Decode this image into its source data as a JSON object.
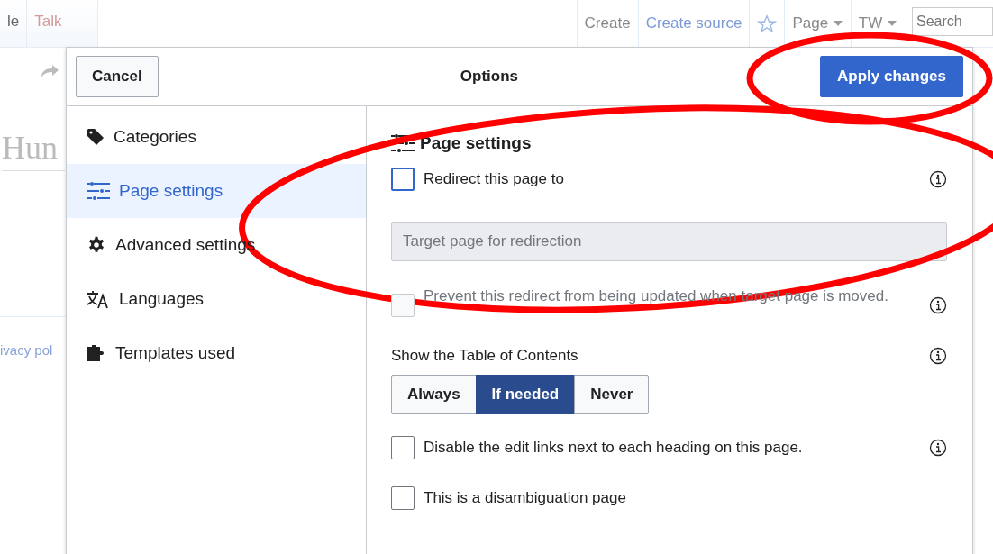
{
  "page": {
    "tabs": [
      {
        "label": "le"
      },
      {
        "label": "Talk"
      }
    ],
    "actions": [
      {
        "kind": "link",
        "label": "Create"
      },
      {
        "kind": "link",
        "label": "Create source"
      },
      {
        "kind": "star"
      },
      {
        "kind": "menu",
        "label": "Page"
      },
      {
        "kind": "menu",
        "label": "TW"
      }
    ],
    "search": {
      "placeholder": "Search"
    },
    "title": "Hun",
    "footer_link": "ivacy pol"
  },
  "dialog": {
    "title": "Options",
    "cancel": "Cancel",
    "apply": "Apply changes",
    "sidebar": [
      {
        "kind": "tag",
        "label": "Categories",
        "selected": false
      },
      {
        "kind": "sliders",
        "label": "Page settings",
        "selected": true
      },
      {
        "kind": "gear",
        "label": "Advanced settings",
        "selected": false
      },
      {
        "kind": "language",
        "label": "Languages",
        "selected": false
      },
      {
        "kind": "puzzle",
        "label": "Templates used",
        "selected": false
      }
    ],
    "heading": "Page settings",
    "rows": [
      {
        "kind": "checkbox",
        "label": "Redirect this page to",
        "checked": false,
        "disabled": false,
        "help": true
      },
      {
        "kind": "field",
        "placeholder": "Target page for redirection",
        "disabled": true
      },
      {
        "kind": "checkbox",
        "label": "Prevent this redirect from being updated when target page is moved.",
        "checked": false,
        "disabled": true,
        "help": true
      },
      {
        "kind": "choice",
        "label": "Show the Table of Contents",
        "help": true,
        "options": [
          {
            "label": "Always",
            "selected": false
          },
          {
            "label": "If needed",
            "selected": true
          },
          {
            "label": "Never",
            "selected": false
          }
        ]
      },
      {
        "kind": "checkbox",
        "label": "Disable the edit links next to each heading on this page.",
        "checked": false,
        "disabled": false,
        "help": true
      },
      {
        "kind": "checkbox",
        "label": "This is a disambiguation page",
        "checked": false,
        "disabled": false,
        "help": false
      }
    ]
  }
}
